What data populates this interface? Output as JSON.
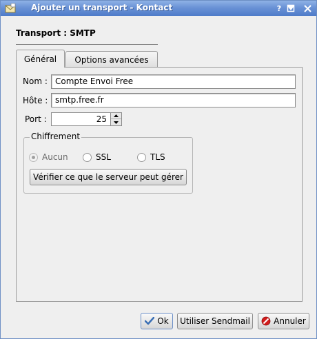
{
  "window": {
    "title": "Ajouter un transport - Kontact",
    "help_glyph": "?",
    "minimize_glyph": "▾",
    "maximize_glyph": "☐",
    "close_glyph": "✕"
  },
  "header": {
    "transport_title": "Transport : SMTP"
  },
  "tabs": [
    {
      "label": "Général",
      "active": true
    },
    {
      "label": "Options avancées",
      "active": false
    }
  ],
  "general": {
    "name_label": "Nom :",
    "name_value": "Compte Envoi Free",
    "host_label": "Hôte :",
    "host_value": "smtp.free.fr",
    "port_label": "Port :",
    "port_value": "25"
  },
  "encryption": {
    "group_title": "Chiffrement",
    "options": [
      {
        "label": "Aucun",
        "checked": true
      },
      {
        "label": "SSL",
        "checked": false
      },
      {
        "label": "TLS",
        "checked": false
      }
    ],
    "check_button_label": "Vérifier ce que le serveur peut gérer"
  },
  "buttons": {
    "ok_label": "Ok",
    "sendmail_label": "Utiliser Sendmail",
    "cancel_label": "Annuler"
  },
  "icons": {
    "app": "envelope-icon",
    "ok": "checkmark-icon",
    "cancel": "stop-icon"
  },
  "colors": {
    "titlebar": "#4f7cc9",
    "window_bg": "#efefef",
    "ok_check": "#3a6fb5",
    "cancel_red": "#d21c1c"
  }
}
